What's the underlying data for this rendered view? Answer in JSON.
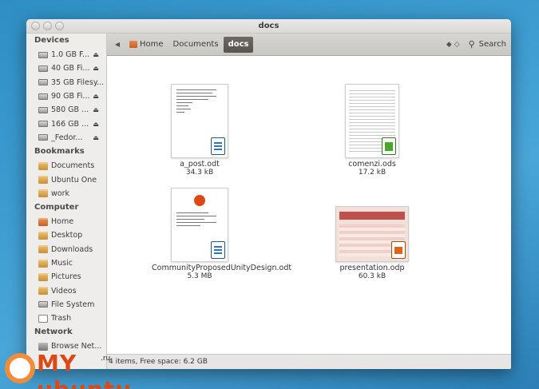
{
  "window": {
    "title": "docs"
  },
  "sidebar": {
    "devices_heading": "Devices",
    "devices": [
      {
        "label": "1.0 GB F...",
        "icon": "drive-icon",
        "eject": true
      },
      {
        "label": "40 GB Fi...",
        "icon": "drive-icon",
        "eject": true
      },
      {
        "label": "35 GB Filesy...",
        "icon": "drive-icon",
        "eject": false
      },
      {
        "label": "90 GB Fi...",
        "icon": "drive-icon",
        "eject": true
      },
      {
        "label": "580 GB ...",
        "icon": "drive-icon",
        "eject": true
      },
      {
        "label": "166 GB ...",
        "icon": "drive-icon",
        "eject": true
      },
      {
        "label": "_Fedor...",
        "icon": "drive-icon",
        "eject": true
      }
    ],
    "bookmarks_heading": "Bookmarks",
    "bookmarks": [
      {
        "label": "Documents",
        "icon": "folder-icon"
      },
      {
        "label": "Ubuntu One",
        "icon": "folder-icon"
      },
      {
        "label": "work",
        "icon": "folder-icon"
      }
    ],
    "computer_heading": "Computer",
    "computer": [
      {
        "label": "Home",
        "icon": "home-folder-icon"
      },
      {
        "label": "Desktop",
        "icon": "folder-icon"
      },
      {
        "label": "Downloads",
        "icon": "folder-icon"
      },
      {
        "label": "Music",
        "icon": "folder-icon"
      },
      {
        "label": "Pictures",
        "icon": "folder-icon"
      },
      {
        "label": "Videos",
        "icon": "folder-icon"
      },
      {
        "label": "File System",
        "icon": "drive-icon"
      },
      {
        "label": "Trash",
        "icon": "trash-icon"
      }
    ],
    "network_heading": "Network",
    "network": [
      {
        "label": "Browse Net...",
        "icon": "network-icon"
      }
    ]
  },
  "toolbar": {
    "breadcrumbs": [
      "Home",
      "Documents",
      "docs"
    ],
    "search_label": "Search"
  },
  "files": [
    {
      "name": "a_post.odt",
      "size": "34.3 kB",
      "type": "writer"
    },
    {
      "name": "comenzi.ods",
      "size": "17.2 kB",
      "type": "calc"
    },
    {
      "name": "CommunityProposedUnityDesign.odt",
      "size": "5.3 MB",
      "type": "writer"
    },
    {
      "name": "presentation.odp",
      "size": "60.3 kB",
      "type": "impress"
    }
  ],
  "statusbar": {
    "text": "4 items, Free space: 6.2 GB"
  },
  "watermark": {
    "text": "MY ubuntu",
    "suffix": ".ru"
  },
  "colors": {
    "accent": "#dd4814",
    "background": "#3d9bd0"
  }
}
